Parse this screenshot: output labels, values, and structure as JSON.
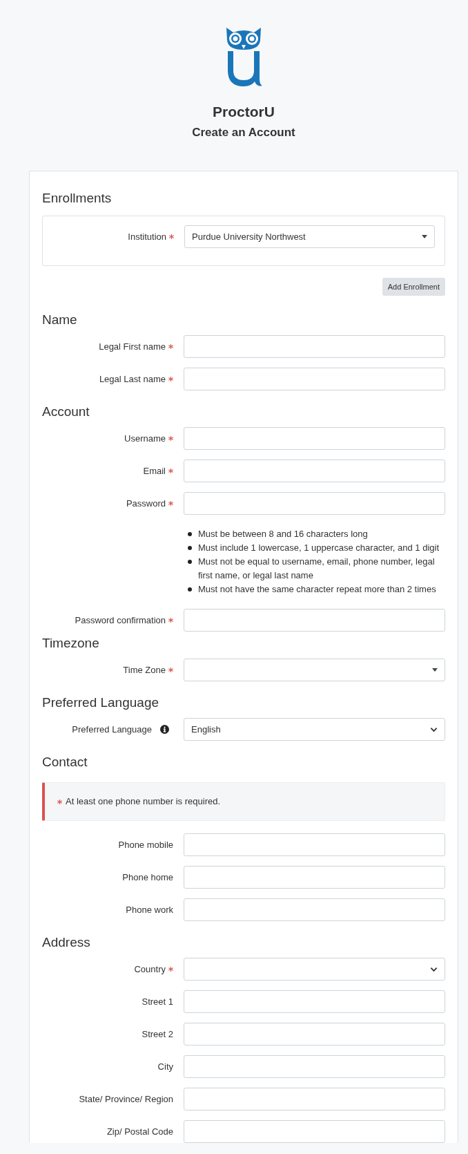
{
  "brand": {
    "name": "ProctorU",
    "subtitle": "Create an Account"
  },
  "sections": [
    {
      "kind": "enrollments",
      "heading": "Enrollments",
      "fields": [
        {
          "label": "Institution",
          "required": true,
          "kind": "combo",
          "value": "Purdue University Northwest"
        }
      ],
      "button": "Add Enrollment"
    },
    {
      "kind": "fields",
      "heading": "Name",
      "fields": [
        {
          "label": "Legal First name",
          "required": true,
          "kind": "text"
        },
        {
          "label": "Legal Last name",
          "required": true,
          "kind": "text"
        }
      ]
    },
    {
      "kind": "fields",
      "heading": "Account",
      "fields": [
        {
          "label": "Username",
          "required": true,
          "kind": "text"
        },
        {
          "label": "Email",
          "required": true,
          "kind": "text"
        },
        {
          "label": "Password",
          "required": true,
          "kind": "text",
          "hints": [
            "Must be between 8 and 16 characters long",
            "Must include 1 lowercase, 1 uppercase character, and 1 digit",
            "Must not be equal to username, email, phone number, legal first name, or legal last name",
            "Must not have the same character repeat more than 2 times"
          ]
        },
        {
          "label": "Password confirmation",
          "required": true,
          "kind": "text"
        }
      ]
    },
    {
      "kind": "fields",
      "heading": "Timezone",
      "fields": [
        {
          "label": "Time Zone",
          "required": true,
          "kind": "combo"
        }
      ]
    },
    {
      "kind": "fields",
      "heading": "Preferred Language",
      "fields": [
        {
          "label": "Preferred Language",
          "required": false,
          "info": true,
          "kind": "select",
          "value": "English"
        }
      ]
    },
    {
      "kind": "fields",
      "heading": "Contact",
      "alert": {
        "required": true,
        "text": "At least one phone number is required."
      },
      "fields": [
        {
          "label": "Phone mobile",
          "required": false,
          "kind": "text"
        },
        {
          "label": "Phone home",
          "required": false,
          "kind": "text"
        },
        {
          "label": "Phone work",
          "required": false,
          "kind": "text"
        }
      ]
    },
    {
      "kind": "fields",
      "heading": "Address",
      "fields": [
        {
          "label": "Country",
          "required": true,
          "kind": "select"
        },
        {
          "label": "Street 1",
          "required": false,
          "kind": "text"
        },
        {
          "label": "Street 2",
          "required": false,
          "kind": "text"
        },
        {
          "label": "City",
          "required": false,
          "kind": "text"
        },
        {
          "label": "State/ Province/ Region",
          "required": false,
          "kind": "text"
        },
        {
          "label": "Zip/ Postal Code",
          "required": false,
          "kind": "text"
        }
      ]
    }
  ]
}
